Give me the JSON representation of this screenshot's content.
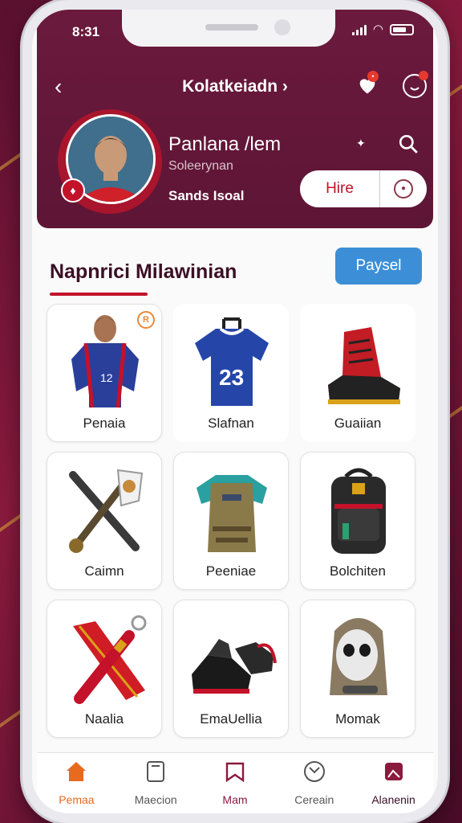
{
  "status_bar": {
    "time": "8:31"
  },
  "header": {
    "title": "Kolatkeiadn ›",
    "profile": {
      "name": "Panlana /lem",
      "subtitle": "Soleerynan",
      "stat": "Sands Isoal"
    },
    "hire_label": "Hire"
  },
  "section": {
    "title": "Napnrici Milawinian",
    "action_label": "Paysel"
  },
  "items": [
    {
      "label": "Penaia",
      "badge": "R",
      "icon": "player-icon"
    },
    {
      "label": "Slafnan",
      "jersey_number": "23",
      "icon": "jersey-icon"
    },
    {
      "label": "Guaiian",
      "icon": "boot-icon"
    },
    {
      "label": "Caimn",
      "icon": "crossed-tools-icon"
    },
    {
      "label": "Peeniae",
      "icon": "vest-icon"
    },
    {
      "label": "Bolchiten",
      "icon": "backpack-icon"
    },
    {
      "label": "Naalia",
      "icon": "scarf-whistle-icon"
    },
    {
      "label": "EmaUellia",
      "icon": "shoes-icon"
    },
    {
      "label": "Momak",
      "icon": "mask-icon"
    }
  ],
  "tabs": [
    {
      "label": "Pemaa",
      "icon": "home-icon",
      "active": true
    },
    {
      "label": "Maecion",
      "icon": "clipboard-icon",
      "active": false
    },
    {
      "label": "Mam",
      "icon": "map-icon",
      "active": false
    },
    {
      "label": "Cereain",
      "icon": "profile-circle-icon",
      "active": false
    },
    {
      "label": "Alanenin",
      "icon": "gallery-icon",
      "active": false
    }
  ],
  "colors": {
    "header_bg": "#6b1a3d",
    "accent_red": "#c3122a",
    "action_blue": "#3c8fd6",
    "active_tab": "#e86a1e"
  }
}
